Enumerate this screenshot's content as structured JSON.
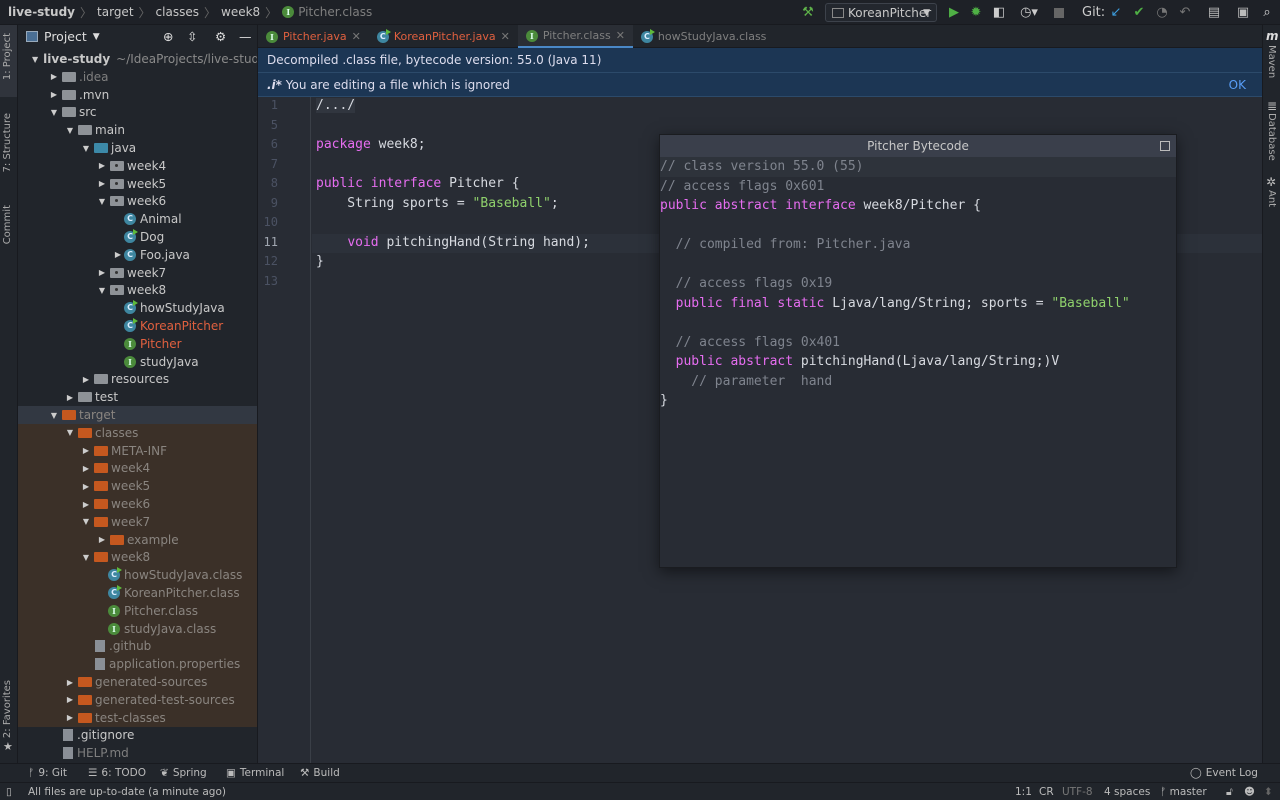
{
  "breadcrumb": [
    "live-study",
    "target",
    "classes",
    "week8",
    "Pitcher.class"
  ],
  "toolbar": {
    "run_config": "KoreanPitcher",
    "git_label": "Git:",
    "icons": [
      "hammer-icon",
      "run-icon",
      "debug-icon",
      "coverage-icon",
      "profile-icon",
      "stop-icon",
      "git-update-icon",
      "git-commit-icon",
      "history-icon",
      "rollback-icon",
      "project-structure-icon",
      "terminal-icon",
      "search-icon"
    ]
  },
  "left_strip": {
    "project": "1: Project",
    "structure": "7: Structure",
    "commit": "Commit",
    "favorites": "2: Favorites"
  },
  "right_strip": {
    "maven": "Maven",
    "database": "Database",
    "ant": "Ant"
  },
  "project": {
    "title": "Project",
    "root_path": "~/IdeaProjects/live-study",
    "tree": [
      {
        "label": "live-study",
        "level": 0,
        "arrow": "open",
        "icon": "module",
        "bold": true
      },
      {
        "label": ".idea",
        "level": 1,
        "arrow": "closed",
        "icon": "folder",
        "style": "dim"
      },
      {
        "label": ".mvn",
        "level": 1,
        "arrow": "closed",
        "icon": "folder"
      },
      {
        "label": "src",
        "level": 1,
        "arrow": "open",
        "icon": "folder"
      },
      {
        "label": "main",
        "level": 2,
        "arrow": "open",
        "icon": "folder"
      },
      {
        "label": "java",
        "level": 3,
        "arrow": "open",
        "icon": "source-folder"
      },
      {
        "label": "week4",
        "level": 4,
        "arrow": "closed",
        "icon": "package"
      },
      {
        "label": "week5",
        "level": 4,
        "arrow": "closed",
        "icon": "package"
      },
      {
        "label": "week6",
        "level": 4,
        "arrow": "open",
        "icon": "package"
      },
      {
        "label": "Animal",
        "level": 5,
        "arrow": "none",
        "icon": "class"
      },
      {
        "label": "Dog",
        "level": 5,
        "arrow": "none",
        "icon": "class-run"
      },
      {
        "label": "Foo.java",
        "level": 5,
        "arrow": "closed",
        "icon": "class"
      },
      {
        "label": "week7",
        "level": 4,
        "arrow": "closed",
        "icon": "package"
      },
      {
        "label": "week8",
        "level": 4,
        "arrow": "open",
        "icon": "package"
      },
      {
        "label": "howStudyJava",
        "level": 5,
        "arrow": "none",
        "icon": "class-run"
      },
      {
        "label": "KoreanPitcher",
        "level": 5,
        "arrow": "none",
        "icon": "class-run",
        "style": "red"
      },
      {
        "label": "Pitcher",
        "level": 5,
        "arrow": "none",
        "icon": "interface",
        "style": "red"
      },
      {
        "label": "studyJava",
        "level": 5,
        "arrow": "none",
        "icon": "interface"
      },
      {
        "label": "resources",
        "level": 3,
        "arrow": "closed",
        "icon": "resources-folder"
      },
      {
        "label": "test",
        "level": 2,
        "arrow": "closed",
        "icon": "folder"
      },
      {
        "label": "target",
        "level": 1,
        "arrow": "open",
        "icon": "excluded-folder",
        "style": "target-sel"
      },
      {
        "label": "classes",
        "level": 2,
        "arrow": "open",
        "icon": "excluded-folder",
        "style": "target"
      },
      {
        "label": "META-INF",
        "level": 3,
        "arrow": "closed",
        "icon": "excluded-folder",
        "style": "target"
      },
      {
        "label": "week4",
        "level": 3,
        "arrow": "closed",
        "icon": "excluded-folder",
        "style": "target"
      },
      {
        "label": "week5",
        "level": 3,
        "arrow": "closed",
        "icon": "excluded-folder",
        "style": "target"
      },
      {
        "label": "week6",
        "level": 3,
        "arrow": "closed",
        "icon": "excluded-folder",
        "style": "target"
      },
      {
        "label": "week7",
        "level": 3,
        "arrow": "open",
        "icon": "excluded-folder",
        "style": "target"
      },
      {
        "label": "example",
        "level": 4,
        "arrow": "closed",
        "icon": "excluded-folder",
        "style": "target"
      },
      {
        "label": "week8",
        "level": 3,
        "arrow": "open",
        "icon": "excluded-folder",
        "style": "target"
      },
      {
        "label": "howStudyJava.class",
        "level": 4,
        "arrow": "none",
        "icon": "class-run",
        "style": "target"
      },
      {
        "label": "KoreanPitcher.class",
        "level": 4,
        "arrow": "none",
        "icon": "class-run",
        "style": "target"
      },
      {
        "label": "Pitcher.class",
        "level": 4,
        "arrow": "none",
        "icon": "interface",
        "style": "target"
      },
      {
        "label": "studyJava.class",
        "level": 4,
        "arrow": "none",
        "icon": "interface",
        "style": "target"
      },
      {
        "label": ".github",
        "level": 3,
        "arrow": "none",
        "icon": "file",
        "style": "target"
      },
      {
        "label": "application.properties",
        "level": 3,
        "arrow": "none",
        "icon": "properties-file",
        "style": "target"
      },
      {
        "label": "generated-sources",
        "level": 2,
        "arrow": "closed",
        "icon": "excluded-folder",
        "style": "target"
      },
      {
        "label": "generated-test-sources",
        "level": 2,
        "arrow": "closed",
        "icon": "excluded-folder",
        "style": "target"
      },
      {
        "label": "test-classes",
        "level": 2,
        "arrow": "closed",
        "icon": "excluded-folder",
        "style": "target"
      },
      {
        "label": ".gitignore",
        "level": 1,
        "arrow": "none",
        "icon": "file"
      },
      {
        "label": "HELP.md",
        "level": 1,
        "arrow": "none",
        "icon": "markdown-file",
        "style": "dim"
      }
    ]
  },
  "tabs": [
    {
      "label": "Pitcher.java",
      "icon": "interface",
      "style": "red"
    },
    {
      "label": "KoreanPitcher.java",
      "icon": "class-run",
      "style": "red"
    },
    {
      "label": "Pitcher.class",
      "icon": "interface",
      "style": "dim",
      "active": true
    },
    {
      "label": "howStudyJava.class",
      "icon": "class-run",
      "style": "dim"
    }
  ],
  "banners": {
    "decompiled": "Decompiled .class file, bytecode version: 55.0 (Java 11)",
    "ignored_prefix": ".i*",
    "ignored": "You are editing a file which is ignored",
    "ok": "OK"
  },
  "editor": {
    "current_line": "11",
    "lines": [
      {
        "n": "1",
        "tokens": [
          [
            "fold",
            "/.../"
          ]
        ]
      },
      {
        "n": "5",
        "tokens": []
      },
      {
        "n": "6",
        "tokens": [
          [
            "kw",
            "package"
          ],
          [
            "t",
            " week8;"
          ]
        ]
      },
      {
        "n": "7",
        "tokens": []
      },
      {
        "n": "8",
        "tokens": [
          [
            "kw",
            "public"
          ],
          [
            "t",
            " "
          ],
          [
            "kw",
            "interface"
          ],
          [
            "t",
            " Pitcher {"
          ]
        ]
      },
      {
        "n": "9",
        "tokens": [
          [
            "t",
            "    String sports = "
          ],
          [
            "str",
            "\"Baseball\""
          ],
          [
            "t",
            ";"
          ]
        ]
      },
      {
        "n": "10",
        "tokens": []
      },
      {
        "n": "11",
        "tokens": [
          [
            "t",
            "    "
          ],
          [
            "kw",
            "void"
          ],
          [
            "t",
            " pitchingHand(String hand);"
          ]
        ]
      },
      {
        "n": "12",
        "tokens": [
          [
            "t",
            "}"
          ]
        ]
      },
      {
        "n": "13",
        "tokens": []
      }
    ]
  },
  "bytecode": {
    "title": "Pitcher Bytecode",
    "lines": [
      [
        [
          "cm",
          "// class version 55.0 (55)"
        ]
      ],
      [
        [
          "cm",
          "// access flags 0x601"
        ]
      ],
      [
        [
          "kw",
          "public"
        ],
        [
          "t",
          " "
        ],
        [
          "kw",
          "abstract"
        ],
        [
          "t",
          " "
        ],
        [
          "kw",
          "interface"
        ],
        [
          "t",
          " week8/Pitcher {"
        ]
      ],
      [],
      [
        [
          "cm",
          "  // compiled from: Pitcher.java"
        ]
      ],
      [],
      [
        [
          "cm",
          "  // access flags 0x19"
        ]
      ],
      [
        [
          "t",
          "  "
        ],
        [
          "kw",
          "public"
        ],
        [
          "t",
          " "
        ],
        [
          "kw",
          "final"
        ],
        [
          "t",
          " "
        ],
        [
          "kw",
          "static"
        ],
        [
          "t",
          " Ljava/lang/String; sports = "
        ],
        [
          "str",
          "\"Baseball\""
        ]
      ],
      [],
      [
        [
          "cm",
          "  // access flags 0x401"
        ]
      ],
      [
        [
          "t",
          "  "
        ],
        [
          "kw",
          "public"
        ],
        [
          "t",
          " "
        ],
        [
          "kw",
          "abstract"
        ],
        [
          "t",
          " pitchingHand(Ljava/lang/String;)V"
        ]
      ],
      [
        [
          "cm",
          "    // parameter  hand"
        ]
      ],
      [
        [
          "t",
          "}"
        ]
      ]
    ]
  },
  "tool_windows": {
    "git": "9: Git",
    "todo": "6: TODO",
    "spring": "Spring",
    "terminal": "Terminal",
    "build": "Build",
    "event_log": "Event Log"
  },
  "status": {
    "message": "All files are up-to-date (a minute ago)",
    "position": "1:1",
    "line_sep": "CR",
    "encoding": "UTF-8",
    "indent": "4 spaces",
    "branch": "master"
  }
}
